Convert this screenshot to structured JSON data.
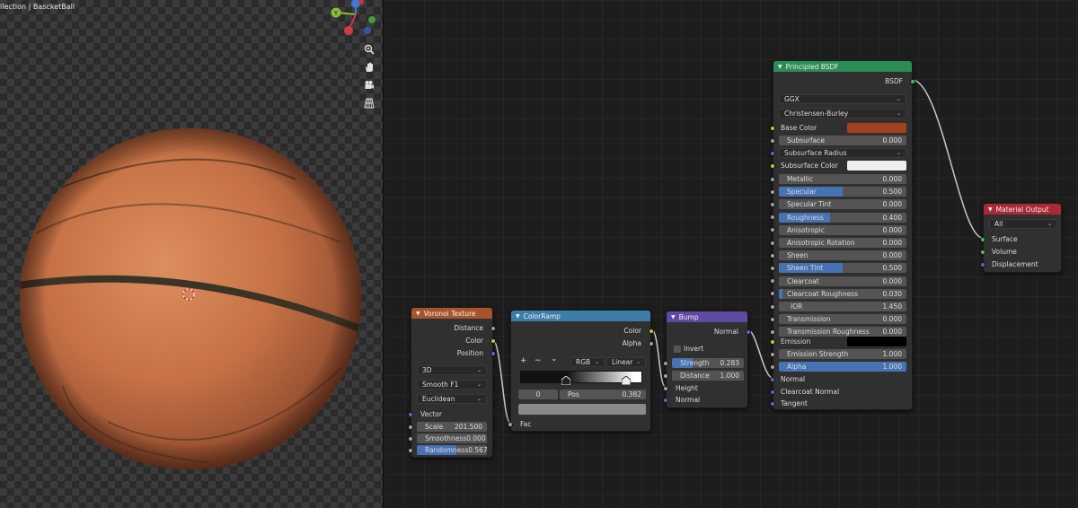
{
  "viewport": {
    "title": "llection | BascketBall",
    "gizmo": {
      "y_label": "Y"
    },
    "tools": [
      "zoom-icon",
      "hand-pan-icon",
      "camera-icon",
      "grid-icon"
    ]
  },
  "nodes": {
    "voronoi": {
      "title": "Voronoi Texture",
      "outputs": [
        "Distance",
        "Color",
        "Position"
      ],
      "dimension": "3D",
      "feature": "Smooth F1",
      "distance_metric": "Euclidean",
      "vector_label": "Vector",
      "scale_label": "Scale",
      "scale_value": "201.500",
      "smoothness_label": "Smoothness",
      "smoothness_value": "0.000",
      "randomness_label": "Randomness",
      "randomness_value": "0.567",
      "randomness_fraction": 0.567
    },
    "colorramp": {
      "title": "ColorRamp",
      "outputs": [
        "Color",
        "Alpha"
      ],
      "plus": "+",
      "minus": "−",
      "chevron": "⌄",
      "color_mode": "RGB",
      "interpolation": "Linear",
      "index": "0",
      "pos_label": "Pos",
      "pos_value": "0.382",
      "fac_label": "Fac"
    },
    "bump": {
      "title": "Bump",
      "output": "Normal",
      "invert_label": "Invert",
      "strength_label": "Strength",
      "strength_value": "0.283",
      "strength_fraction": 0.283,
      "distance_label": "Distance",
      "distance_value": "1.000",
      "inputs": [
        "Height",
        "Normal"
      ]
    },
    "principled": {
      "title": "Principled BSDF",
      "output": "BSDF",
      "distribution": "GGX",
      "subsurface_method": "Christensen-Burley",
      "base_color_label": "Base Color",
      "base_color": "#a3411f",
      "subsurface_label": "Subsurface",
      "subsurface_value": "0.000",
      "subsurface_radius_label": "Subsurface Radius",
      "subsurface_color_label": "Subsurface Color",
      "subsurface_color": "#eeeeee",
      "params": [
        {
          "label": "Metallic",
          "value": "0.000",
          "fraction": 0
        },
        {
          "label": "Specular",
          "value": "0.500",
          "fraction": 0.5
        },
        {
          "label": "Specular Tint",
          "value": "0.000",
          "fraction": 0
        },
        {
          "label": "Roughness",
          "value": "0.400",
          "fraction": 0.4
        },
        {
          "label": "Anisotropic",
          "value": "0.000",
          "fraction": 0
        },
        {
          "label": "Anisotropic Rotation",
          "value": "0.000",
          "fraction": 0
        },
        {
          "label": "Sheen",
          "value": "0.000",
          "fraction": 0
        },
        {
          "label": "Sheen Tint",
          "value": "0.500",
          "fraction": 0.5
        },
        {
          "label": "Clearcoat",
          "value": "0.000",
          "fraction": 0
        },
        {
          "label": "Clearcoat Roughness",
          "value": "0.030",
          "fraction": 0.03
        },
        {
          "label": "IOR",
          "value": "1.450",
          "fraction": 0
        },
        {
          "label": "Transmission",
          "value": "0.000",
          "fraction": 0
        },
        {
          "label": "Transmission Roughness",
          "value": "0.000",
          "fraction": 0
        }
      ],
      "emission_label": "Emission",
      "emission_color": "#000000",
      "emission_strength_label": "Emission Strength",
      "emission_strength_value": "1.000",
      "alpha_label": "Alpha",
      "alpha_value": "1.000",
      "inputs": [
        "Normal",
        "Clearcoat Normal",
        "Tangent"
      ]
    },
    "output": {
      "title": "Material Output",
      "target": "All",
      "inputs": [
        "Surface",
        "Volume",
        "Displacement"
      ]
    }
  },
  "colors": {
    "ball": "#c86a3a",
    "seam": "#3a3426",
    "header_texture": "#a7542b",
    "header_converter": "#3c7ea9",
    "header_vector": "#5e4aa3",
    "header_shader": "#2c8c56",
    "header_output": "#a82a35"
  }
}
